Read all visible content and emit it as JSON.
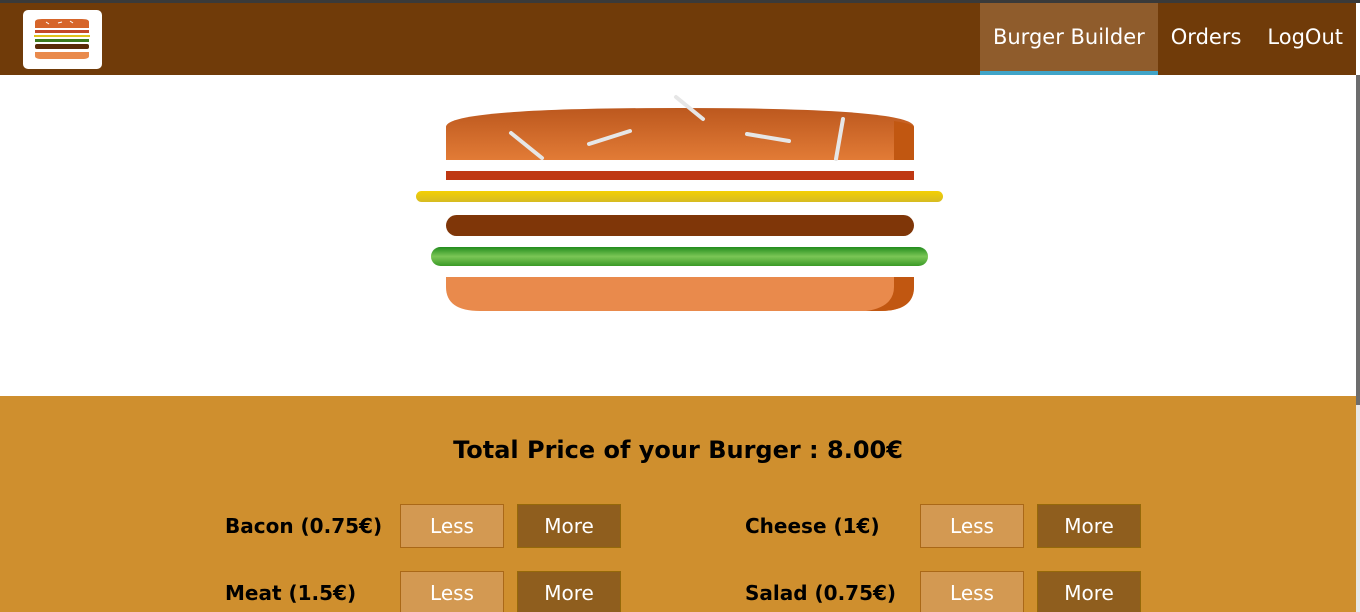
{
  "nav": {
    "items": [
      {
        "label": "Burger Builder",
        "active": true
      },
      {
        "label": "Orders",
        "active": false
      },
      {
        "label": "LogOut",
        "active": false
      }
    ]
  },
  "burger": {
    "ingredients": [
      "bread-top",
      "bacon",
      "cheese",
      "meat",
      "salad",
      "bread-bottom"
    ]
  },
  "build_controls": {
    "price_text": "Total Price of your Burger : 8.00€",
    "controls": [
      {
        "label": "Bacon (0.75€)",
        "less": "Less",
        "more": "More"
      },
      {
        "label": "Cheese (1€)",
        "less": "Less",
        "more": "More"
      },
      {
        "label": "Meat (1.5€)",
        "less": "Less",
        "more": "More"
      },
      {
        "label": "Salad (0.75€)",
        "less": "Less",
        "more": "More"
      }
    ]
  },
  "colors": {
    "toolbar": "#703b09",
    "active_nav": "#8f5c2c",
    "active_underline": "#40a4c8",
    "controls_bg": "#cf8f2e",
    "less_button": "#d39952",
    "more_button": "#8f5e1e"
  },
  "icons": [
    "burger-logo-icon"
  ]
}
